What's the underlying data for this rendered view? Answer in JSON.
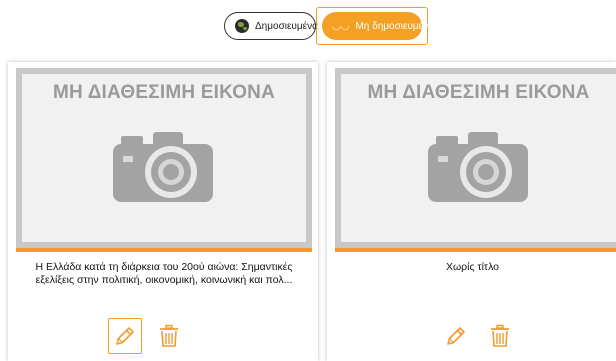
{
  "filters": {
    "published_label": "Δημοσιευμένα",
    "unpublished_label": "Μη δημοσιευμένα",
    "active": "unpublished"
  },
  "placeholder_text": "ΜΗ ΔΙΑΘΕΣΙΜΗ ΕΙΚΟΝΑ",
  "cards": [
    {
      "title": "Η Ελλάδα κατά τη διάρκεια του 20ού αιώνα: Σημαντικές εξελίξεις στην πολιτική, οικονομική, κοινωνική και πολ...",
      "edit_icon": "pencil-icon",
      "delete_icon": "trash-icon"
    },
    {
      "title": "Χωρίς τίτλο",
      "edit_icon": "pencil-icon",
      "delete_icon": "trash-icon"
    }
  ],
  "colors": {
    "accent": "#f39a2b",
    "pill_active_bg": "#f3a024",
    "placeholder_text": "#9a9a9a",
    "placeholder_border": "#c8c8c8"
  }
}
